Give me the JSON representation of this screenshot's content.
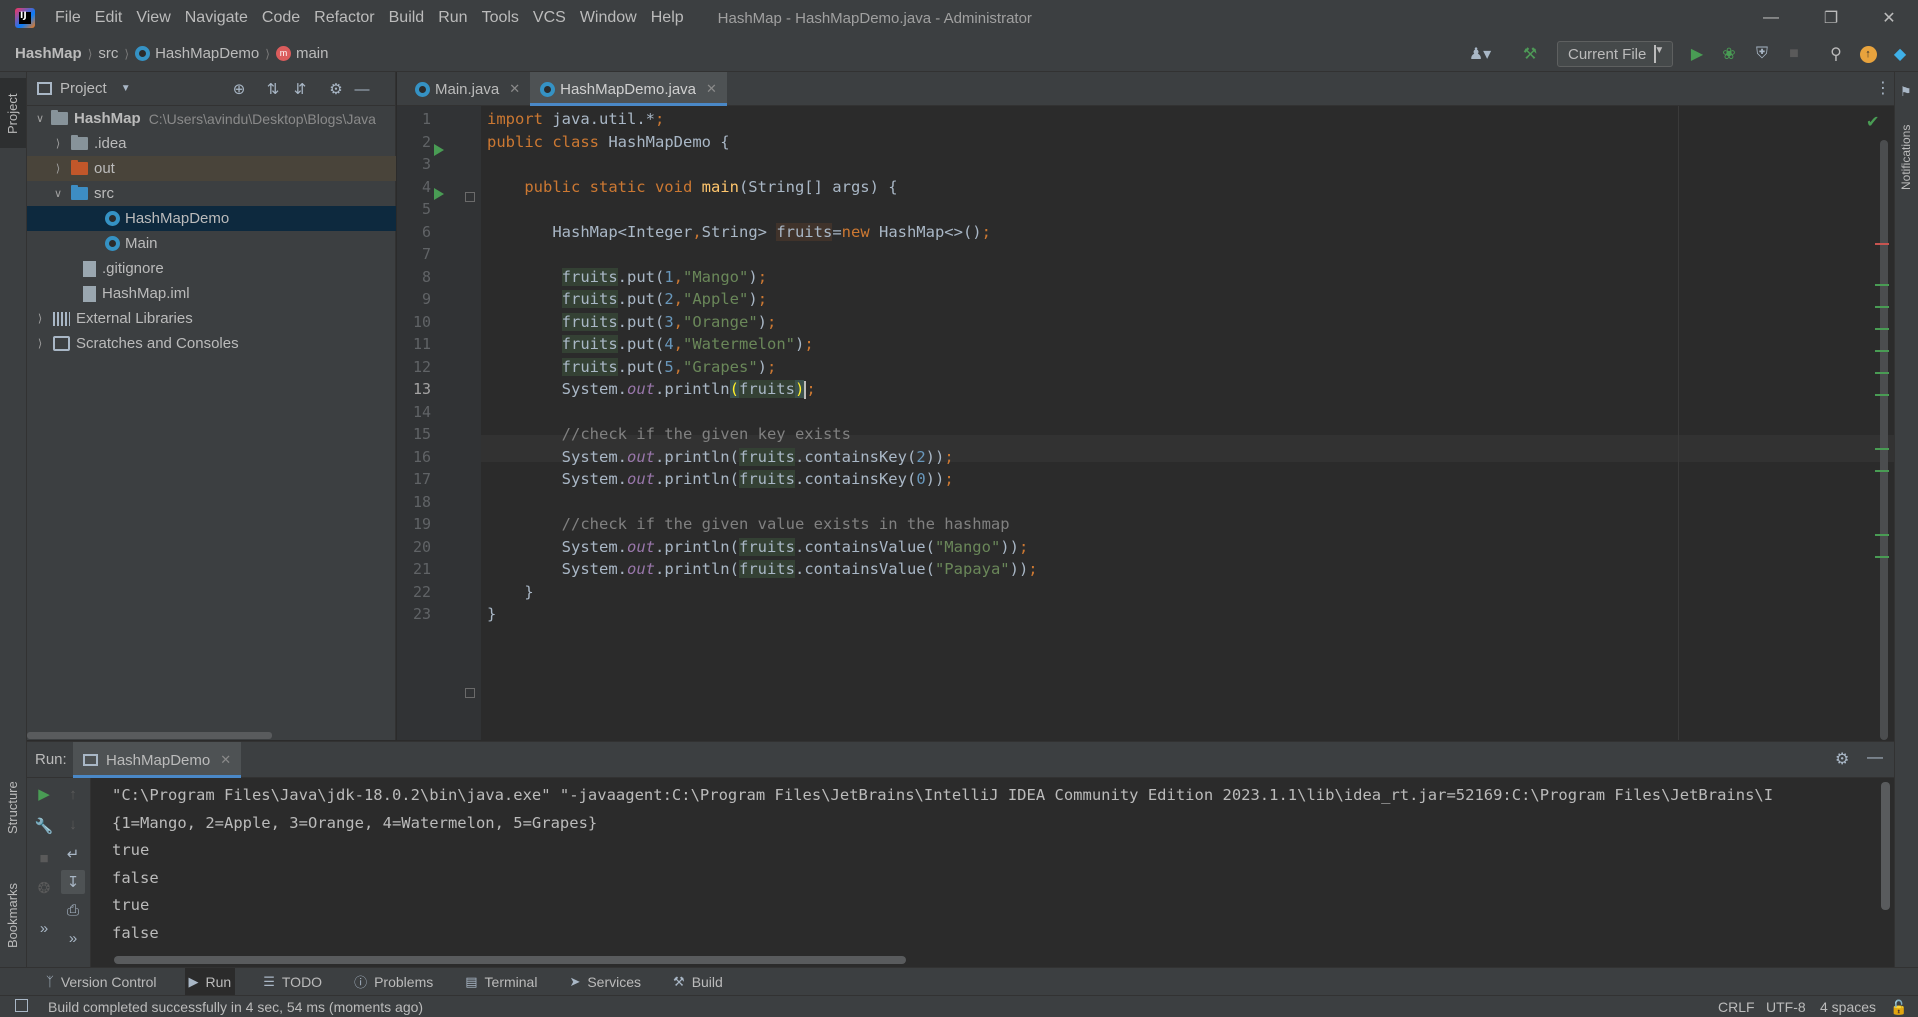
{
  "app": {
    "window_title": "HashMap - HashMapDemo.java - Administrator",
    "menu": [
      "File",
      "Edit",
      "View",
      "Navigate",
      "Code",
      "Refactor",
      "Build",
      "Run",
      "Tools",
      "VCS",
      "Window",
      "Help"
    ]
  },
  "breadcrumb": {
    "project": "HashMap",
    "folder": "src",
    "file": "HashMapDemo",
    "method": "main"
  },
  "toolbar": {
    "run_config": "Current File"
  },
  "project_panel": {
    "title": "Project",
    "tree": [
      {
        "label": "HashMap",
        "path": "C:\\Users\\avindu\\Desktop\\Blogs\\Java"
      },
      {
        "label": ".idea"
      },
      {
        "label": "out"
      },
      {
        "label": "src"
      },
      {
        "label": "HashMapDemo"
      },
      {
        "label": "Main"
      },
      {
        "label": ".gitignore"
      },
      {
        "label": "HashMap.iml"
      },
      {
        "label": "External Libraries"
      },
      {
        "label": "Scratches and Consoles"
      }
    ]
  },
  "editor": {
    "tabs": [
      {
        "label": "Main.java"
      },
      {
        "label": "HashMapDemo.java"
      }
    ],
    "current_line": 13,
    "line_numbers": [
      "1",
      "2",
      "3",
      "4",
      "5",
      "6",
      "7",
      "8",
      "9",
      "10",
      "11",
      "12",
      "13",
      "14",
      "15",
      "16",
      "17",
      "18",
      "19",
      "20",
      "21",
      "22",
      "23"
    ]
  },
  "left_strip": {
    "project": "Project",
    "structure": "Structure",
    "bookmarks": "Bookmarks"
  },
  "right_strip": {
    "notifications": "Notifications"
  },
  "run_panel": {
    "label": "Run:",
    "tab": "HashMapDemo",
    "output": [
      "\"C:\\Program Files\\Java\\jdk-18.0.2\\bin\\java.exe\" \"-javaagent:C:\\Program Files\\JetBrains\\IntelliJ IDEA Community Edition 2023.1.1\\lib\\idea_rt.jar=52169:C:\\Program Files\\JetBrains\\I",
      "{1=Mango, 2=Apple, 3=Orange, 4=Watermelon, 5=Grapes}",
      "true",
      "false",
      "true",
      "false"
    ]
  },
  "bottom_tools": [
    {
      "label": "Version Control",
      "icon": "branch-icon"
    },
    {
      "label": "Run",
      "icon": "play-icon"
    },
    {
      "label": "TODO",
      "icon": "list-icon"
    },
    {
      "label": "Problems",
      "icon": "problems-icon"
    },
    {
      "label": "Terminal",
      "icon": "terminal-icon"
    },
    {
      "label": "Services",
      "icon": "services-icon"
    },
    {
      "label": "Build",
      "icon": "hammer-icon"
    }
  ],
  "status": {
    "message": "Build completed successfully in 4 sec, 54 ms (moments ago)",
    "line_separator": "CRLF",
    "encoding": "UTF-8",
    "indent": "4 spaces"
  },
  "colors": {
    "accent": "#4a88c7",
    "run_green": "#499c54",
    "keyword": "#cc7832",
    "string": "#6a8759",
    "number": "#6897bb"
  }
}
